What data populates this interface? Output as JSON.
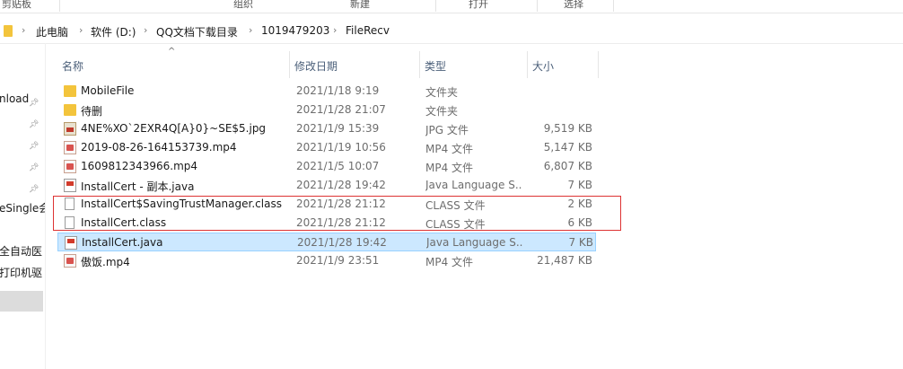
{
  "ribbon": {
    "groups": [
      "剪贴板",
      "组织",
      "新建",
      "打开",
      "选择"
    ]
  },
  "address": {
    "crumbs": [
      "此电脑",
      "软件 (D:)",
      "QQ文档下载目录",
      "1019479203",
      "FileRecv"
    ]
  },
  "nav": {
    "items": [
      "nload",
      "eSingle会",
      "全自动医",
      "打印机驱"
    ]
  },
  "columns": {
    "name": "名称",
    "date": "修改日期",
    "type": "类型",
    "size": "大小"
  },
  "files": [
    {
      "name": "MobileFile",
      "date": "2021/1/18 9:19",
      "type": "文件夹",
      "size": "",
      "icon": "folder-icon"
    },
    {
      "name": "待删",
      "date": "2021/1/28 21:07",
      "type": "文件夹",
      "size": "",
      "icon": "folder-icon"
    },
    {
      "name": "4NE%XO`2EXR4Q[A}0}~SE$5.jpg",
      "date": "2021/1/9 15:39",
      "type": "JPG 文件",
      "size": "9,519 KB",
      "icon": "jpg-icon"
    },
    {
      "name": "2019-08-26-164153739.mp4",
      "date": "2021/1/19 10:56",
      "type": "MP4 文件",
      "size": "5,147 KB",
      "icon": "mp4-icon"
    },
    {
      "name": "1609812343966.mp4",
      "date": "2021/1/5 10:07",
      "type": "MP4 文件",
      "size": "6,807 KB",
      "icon": "mp4-icon"
    },
    {
      "name": "InstallCert - 副本.java",
      "date": "2021/1/28 19:42",
      "type": "Java Language S...",
      "size": "7 KB",
      "icon": "java-icon"
    },
    {
      "name": "InstallCert$SavingTrustManager.class",
      "date": "2021/1/28 21:12",
      "type": "CLASS 文件",
      "size": "2 KB",
      "icon": "class-file-icon"
    },
    {
      "name": "InstallCert.class",
      "date": "2021/1/28 21:12",
      "type": "CLASS 文件",
      "size": "6 KB",
      "icon": "class-file-icon"
    },
    {
      "name": "InstallCert.java",
      "date": "2021/1/28 19:42",
      "type": "Java Language S...",
      "size": "7 KB",
      "icon": "java-icon",
      "selected": true
    },
    {
      "name": "傲饭.mp4",
      "date": "2021/1/9 23:51",
      "type": "MP4 文件",
      "size": "21,487 KB",
      "icon": "mp4-icon"
    }
  ],
  "colors": {
    "selection_bg": "#cce8ff",
    "highlight_border": "#dd3333",
    "folder": "#f3c43c"
  }
}
